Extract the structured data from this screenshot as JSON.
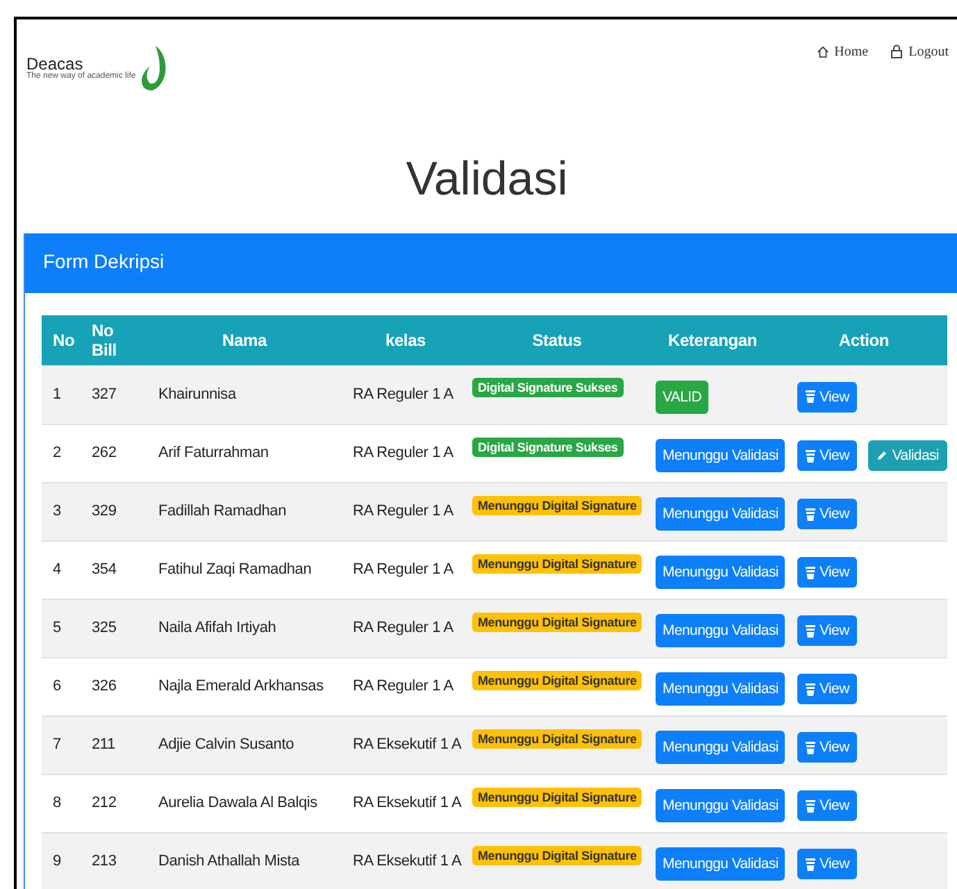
{
  "logo": {
    "name": "Deacas",
    "tagline": "The new way of academic life"
  },
  "nav": [
    {
      "label": "Home"
    },
    {
      "label": "Logout"
    }
  ],
  "title": "Validasi",
  "card": {
    "title": "Form Dekripsi"
  },
  "table": {
    "columns": [
      "No",
      "No Bill",
      "Nama",
      "kelas",
      "Status",
      "Keterangan",
      "Action"
    ],
    "rows": [
      {
        "no": "1",
        "bill": "327",
        "nama": "Khairunnisa",
        "kelas": "RA Reguler 1 A",
        "status": {
          "kind": "success",
          "text": "Digital Signature Sukses"
        },
        "keterangan": {
          "kind": "valid",
          "text": "VALID"
        },
        "view": "View",
        "validasi": null
      },
      {
        "no": "2",
        "bill": "262",
        "nama": "Arif Faturrahman",
        "kelas": "RA Reguler 1 A",
        "status": {
          "kind": "success",
          "text": "Digital Signature Sukses"
        },
        "keterangan": {
          "kind": "waiting",
          "text": "Menunggu Validasi"
        },
        "view": "View",
        "validasi": "Validasi"
      },
      {
        "no": "3",
        "bill": "329",
        "nama": "Fadillah Ramadhan",
        "kelas": "RA Reguler 1 A",
        "status": {
          "kind": "waiting",
          "text": "Menunggu Digital Signature"
        },
        "keterangan": {
          "kind": "waiting",
          "text": "Menunggu Validasi"
        },
        "view": "View",
        "validasi": null
      },
      {
        "no": "4",
        "bill": "354",
        "nama": "Fatihul Zaqi Ramadhan",
        "kelas": "RA Reguler 1 A",
        "status": {
          "kind": "waiting",
          "text": "Menunggu Digital Signature"
        },
        "keterangan": {
          "kind": "waiting",
          "text": "Menunggu Validasi"
        },
        "view": "View",
        "validasi": null
      },
      {
        "no": "5",
        "bill": "325",
        "nama": "Naila Afifah Irtiyah",
        "kelas": "RA Reguler 1 A",
        "status": {
          "kind": "waiting",
          "text": "Menunggu Digital Signature"
        },
        "keterangan": {
          "kind": "waiting",
          "text": "Menunggu Validasi"
        },
        "view": "View",
        "validasi": null
      },
      {
        "no": "6",
        "bill": "326",
        "nama": "Najla Emerald Arkhansas",
        "kelas": "RA Reguler 1 A",
        "status": {
          "kind": "waiting",
          "text": "Menunggu Digital Signature"
        },
        "keterangan": {
          "kind": "waiting",
          "text": "Menunggu Validasi"
        },
        "view": "View",
        "validasi": null
      },
      {
        "no": "7",
        "bill": "211",
        "nama": "Adjie Calvin Susanto",
        "kelas": "RA Eksekutif 1 A",
        "status": {
          "kind": "waiting",
          "text": "Menunggu Digital Signature"
        },
        "keterangan": {
          "kind": "waiting",
          "text": "Menunggu Validasi"
        },
        "view": "View",
        "validasi": null
      },
      {
        "no": "8",
        "bill": "212",
        "nama": "Aurelia Dawala Al Balqis",
        "kelas": "RA Eksekutif 1 A",
        "status": {
          "kind": "waiting",
          "text": "Menunggu Digital Signature"
        },
        "keterangan": {
          "kind": "waiting",
          "text": "Menunggu Validasi"
        },
        "view": "View",
        "validasi": null
      },
      {
        "no": "9",
        "bill": "213",
        "nama": "Danish Athallah Mista",
        "kelas": "RA Eksekutif 1 A",
        "status": {
          "kind": "waiting",
          "text": "Menunggu Digital Signature"
        },
        "keterangan": {
          "kind": "waiting",
          "text": "Menunggu Validasi"
        },
        "view": "View",
        "validasi": null
      }
    ]
  }
}
